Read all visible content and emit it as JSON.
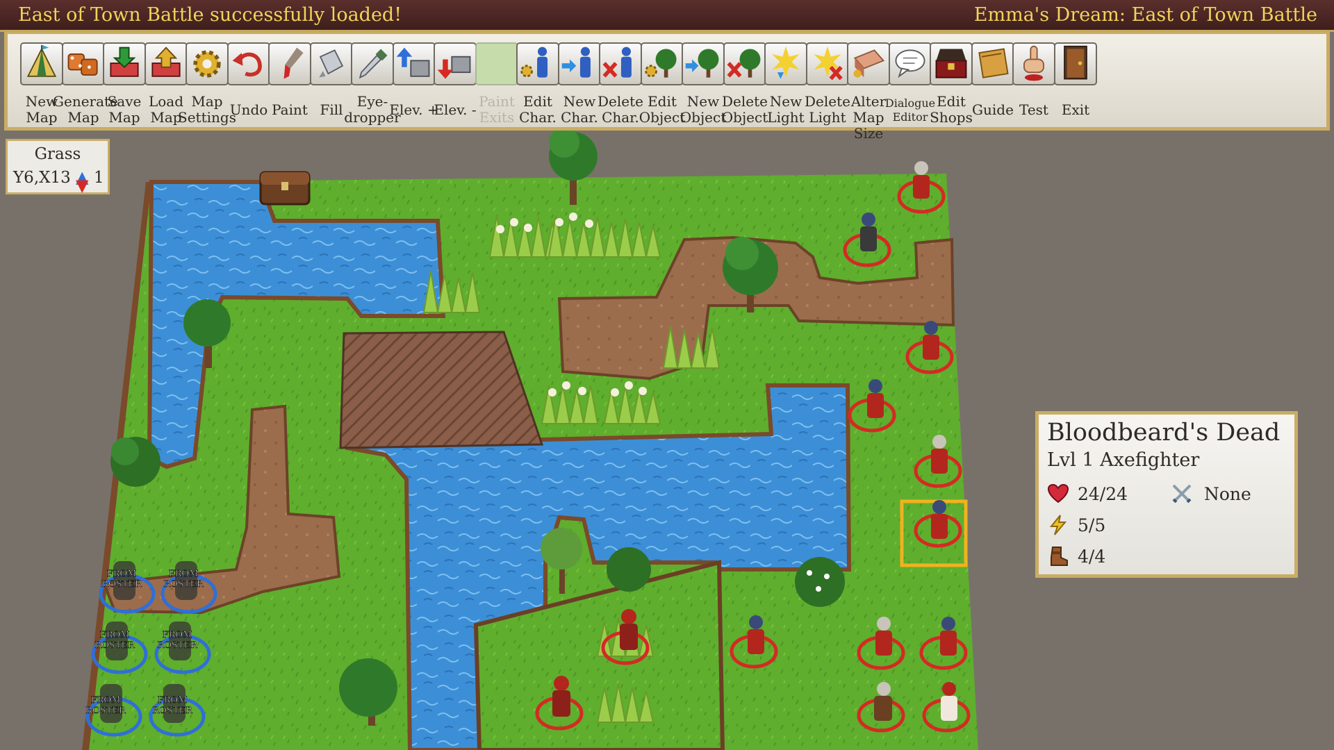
{
  "titlebar": {
    "status_message": "East of Town Battle successfully loaded!",
    "map_title": "Emma's Dream: East of Town Battle"
  },
  "toolbar": {
    "tools": [
      {
        "label": "New\nMap",
        "icon": "tent-icon"
      },
      {
        "label": "Generate\nMap",
        "icon": "dice-icon"
      },
      {
        "label": "Save\nMap",
        "icon": "save-icon"
      },
      {
        "label": "Load\nMap",
        "icon": "load-icon"
      },
      {
        "label": "Map\nSettings",
        "icon": "gear-icon"
      },
      {
        "label": "Undo",
        "icon": "undo-icon"
      },
      {
        "label": "Paint",
        "icon": "paintbrush-icon"
      },
      {
        "label": "Fill",
        "icon": "paint-bucket-icon"
      },
      {
        "label": "Eye-\ndropper",
        "icon": "eyedropper-icon"
      },
      {
        "label": "Elev. +",
        "icon": "elevation-up-icon"
      },
      {
        "label": "Elev. -",
        "icon": "elevation-down-icon"
      },
      {
        "label": "Paint\nExits",
        "icon": "paint-exits-icon",
        "disabled": true
      },
      {
        "label": "Edit\nChar.",
        "icon": "edit-character-icon"
      },
      {
        "label": "New\nChar.",
        "icon": "new-character-icon"
      },
      {
        "label": "Delete\nChar.",
        "icon": "delete-character-icon"
      },
      {
        "label": "Edit\nObject",
        "icon": "edit-object-icon"
      },
      {
        "label": "New\nObject",
        "icon": "new-object-icon"
      },
      {
        "label": "Delete\nObject",
        "icon": "delete-object-icon"
      },
      {
        "label": "New\nLight",
        "icon": "new-light-icon"
      },
      {
        "label": "Delete\nLight",
        "icon": "delete-light-icon"
      },
      {
        "label": "Alter\nMap Size",
        "icon": "alter-map-size-icon"
      },
      {
        "label": "Dialogue\nEditor",
        "icon": "speech-bubble-icon",
        "small": true
      },
      {
        "label": "Edit\nShops",
        "icon": "treasure-chest-icon"
      },
      {
        "label": "Guide",
        "icon": "book-icon"
      },
      {
        "label": "Test",
        "icon": "pointing-hand-icon"
      },
      {
        "label": "Exit",
        "icon": "door-icon"
      }
    ]
  },
  "tile_info": {
    "terrain": "Grass",
    "coords": "Y6,X13",
    "elevation": "1",
    "elevation_icon": "up-down-arrow-icon"
  },
  "map": {
    "roster_label": "FROM\nROSTER",
    "roster_slots": 6,
    "colors": {
      "grass": "#5fae2e",
      "water": "#3c8fd6",
      "dirt": "#9c6d4c",
      "enemy_ring": "#d42a23",
      "ally_ring": "#2f6fd8",
      "selection": "#f0b21e"
    }
  },
  "unit_panel": {
    "name": "Bloodbeard's Dead",
    "class": "Lvl 1 Axefighter",
    "hp": "24/24",
    "equipment": "None",
    "energy": "5/5",
    "movement": "4/4",
    "icons": {
      "hp": "heart-icon",
      "equipment": "crossed-swords-icon",
      "energy": "lightning-icon",
      "movement": "boot-icon"
    }
  }
}
